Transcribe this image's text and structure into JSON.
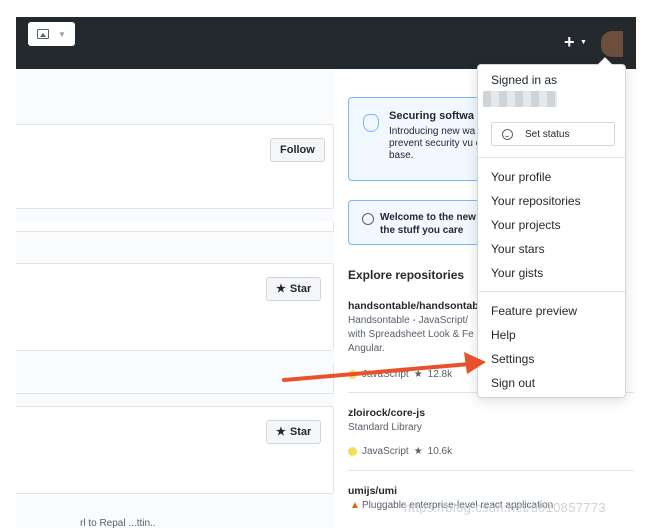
{
  "dropdown": {
    "signed_in_label": "Signed in as",
    "set_status_label": "Set status",
    "items": [
      "Your profile",
      "Your repositories",
      "Your projects",
      "Your stars",
      "Your gists",
      "Feature preview",
      "Help",
      "Settings",
      "Sign out"
    ]
  },
  "feed": {
    "follow_label": "Follow",
    "star_label": "Star"
  },
  "sidebar": {
    "securing_title": "Securing softwa",
    "securing_text": "Introducing new wa prevent security vu code base.",
    "welcome_text": "Welcome to the new to the stuff you care",
    "explore_title": "Explore repositories",
    "repos": [
      {
        "name": "handsontable/handsontab",
        "description": "Handsontable - JavaScript/ with Spreadsheet Look & Fe Angular.",
        "language": "JavaScript",
        "stars": "12.8k"
      },
      {
        "name": "zloirock/core-js",
        "description": "Standard Library",
        "language": "JavaScript",
        "stars": "10.6k"
      },
      {
        "name": "umijs/umi",
        "description": "Pluggable enterprise-level react application"
      }
    ]
  },
  "watermark": "https://blog.csdn.net/u010857773",
  "footer_text": "rl to Repal    ...ttin..",
  "colors": {
    "header": "#24292e",
    "arrow": "#e8512a",
    "link_box_border": "#79b8ff",
    "lang_javascript": "#f1e05a"
  }
}
